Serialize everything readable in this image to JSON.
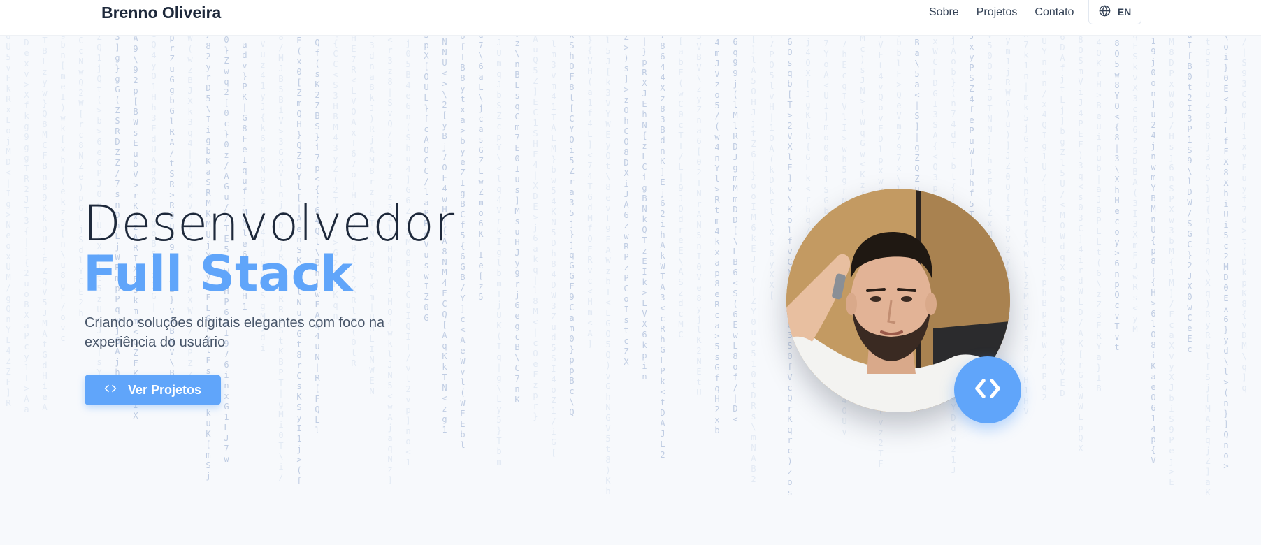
{
  "header": {
    "brand": "Brenno Oliveira",
    "nav": [
      {
        "label": "Sobre"
      },
      {
        "label": "Projetos"
      },
      {
        "label": "Contato"
      }
    ],
    "language_label": "EN"
  },
  "hero": {
    "title_line1": "Desenvolvedor",
    "title_line2": "Full Stack",
    "subtitle": "Criando soluções digitais elegantes com foco na experiência do usuário",
    "cta_label": "Ver Projetos"
  },
  "profile": {
    "photo_alt": "avatar",
    "badge_icon": "code-icon"
  },
  "colors": {
    "accent": "#60a5fa",
    "text_dark": "#1e293b",
    "text_muted": "#475569",
    "background": "#f7f9fc",
    "matrix_glyph": "#c7d3e6"
  }
}
